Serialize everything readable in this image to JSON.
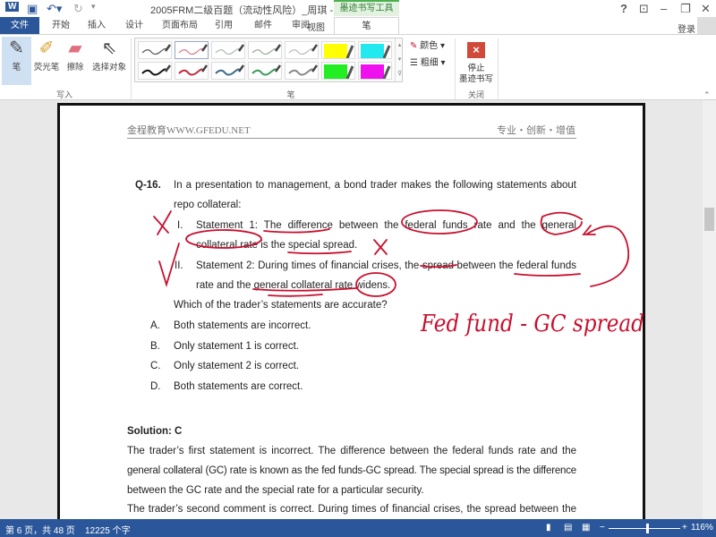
{
  "titlebar": {
    "title": "2005FRM二级百题（流动性风险）_周琪 - Word",
    "context_tab": "墨迹书写工具",
    "help": "?",
    "minimize": "–",
    "restore": "❐",
    "close": "✕",
    "ribbon_display": "⊡"
  },
  "tabs": [
    "文件",
    "开始",
    "插入",
    "设计",
    "页面布局",
    "引用",
    "邮件",
    "审阅",
    "视图",
    "笔"
  ],
  "account": {
    "login": "登录"
  },
  "ribbon": {
    "write_tools": [
      {
        "label": "笔",
        "icon": "✎"
      },
      {
        "label": "荧光笔",
        "icon": "✐"
      },
      {
        "label": "擦除",
        "icon": "▰"
      },
      {
        "label": "选择对象",
        "icon": "⇖"
      }
    ],
    "group_write": "写入",
    "group_pens": "笔",
    "group_close": "关闭",
    "color_label": "颜色",
    "weight_label": "粗细",
    "stop_label_1": "停止",
    "stop_label_2": "墨迹书写",
    "pen_colors": [
      "#555555",
      "#d9788a",
      "#b0b8b8",
      "#9aa8a0",
      "#bbbbbb",
      "#ffff00",
      "#22e8f0",
      "#111111",
      "#c2283c",
      "#3a6a8a",
      "#3a9a5a",
      "#888888",
      "#22ee22",
      "#ee11ee"
    ]
  },
  "document": {
    "header_left": "金程教育WWW.GFEDU.NET",
    "header_right": "专业・创新・增值",
    "q_num": "Q-16.",
    "q_line1": "In a presentation to management, a bond trader makes the following statements about",
    "q_line2": "repo collateral:",
    "s1_num": "I.",
    "s1_line1": "Statement 1: The difference between the federal funds rate and the general",
    "s1_line2": "collateral rate is the special spread.",
    "s2_num": "II.",
    "s2_line1": "Statement 2: During times of financial crises, the spread between the federal funds",
    "s2_line2": "rate and the general collateral rate widens.",
    "question": "Which of the trader’s statements are accurate?",
    "options": [
      {
        "letter": "A.",
        "text": "Both statements are incorrect."
      },
      {
        "letter": "B.",
        "text": "Only statement 1 is correct."
      },
      {
        "letter": "C.",
        "text": "Only statement 2 is correct."
      },
      {
        "letter": "D.",
        "text": "Both statements are correct."
      }
    ],
    "solution_title": "Solution: C",
    "sol_lines": [
      "The trader’s first statement is incorrect. The difference between the federal funds rate and the",
      "general collateral (GC) rate is known as the fed funds-GC spread. The special spread is the difference",
      "between the GC rate and the special rate for a particular security.",
      "The trader’s second comment is correct. During times of financial crises, the spread between the"
    ],
    "ink_note": "Fed fund - GC spread",
    "ink_color": "#c8102e"
  },
  "status": {
    "page": "第 6 页，共 48 页",
    "words": "12225 个字",
    "zoom": "116%",
    "zoom_level_percent": 116
  }
}
